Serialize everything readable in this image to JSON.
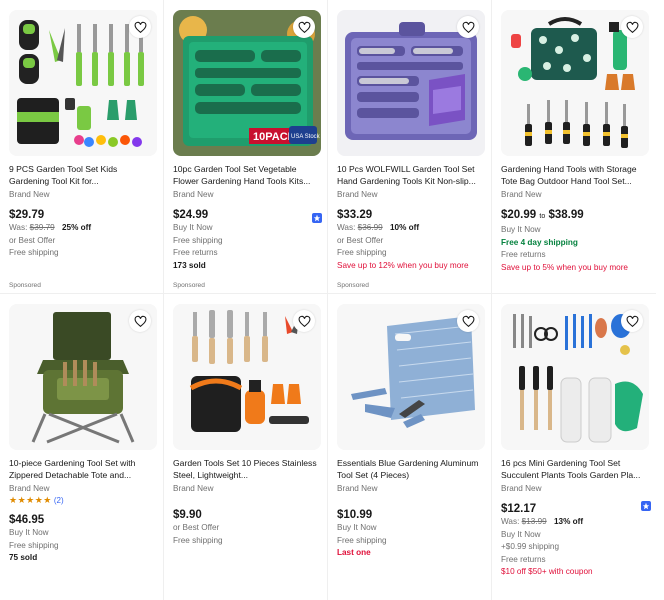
{
  "listings": [
    {
      "title": "9 PCS Garden Tool Set Kids Gardening Tool Kit for...",
      "condition": "Brand New",
      "price": "$29.79",
      "was_label": "Was:",
      "was_price": "$39.79",
      "discount": "25% off",
      "lines": [
        "or Best Offer",
        "Free shipping"
      ],
      "sponsored": "Sponsored",
      "image_icon": "garden-tool-kit-with-bag-image"
    },
    {
      "title": "10pc Garden Tool Set Vegetable Flower Gardening Hand Tools Kits...",
      "condition": "Brand New",
      "price": "$24.99",
      "lines": [
        "Buy It Now",
        "Free shipping",
        "Free returns"
      ],
      "sold": "173 sold",
      "sponsored": "Sponsored",
      "image_icon": "green-tool-case-image",
      "image_text": "10PACK",
      "image_stock_text": "USA Stock"
    },
    {
      "title": "10 Pcs WOLFWILL Garden Tool Set Hand Gardening Tools Kit Non-slip...",
      "condition": "Brand New",
      "price": "$33.29",
      "was_label": "Was:",
      "was_price": "$36.99",
      "discount": "10% off",
      "lines": [
        "or Best Offer",
        "Free shipping"
      ],
      "promo": "Save up to 12% when you buy more",
      "sponsored": "Sponsored",
      "image_icon": "purple-tool-case-image"
    },
    {
      "title": "Gardening Hand Tools with Storage Tote Bag Outdoor Hand Tool Set...",
      "condition": "Brand New",
      "price": "$20.99",
      "price_to": "to",
      "price_high": "$38.99",
      "lines": [
        "Buy It Now"
      ],
      "shipping_highlight": "Free 4 day shipping",
      "lines_after": [
        "Free returns"
      ],
      "promo": "Save up to 5% when you buy more",
      "image_icon": "tote-bag-tool-set-image"
    },
    {
      "title": "10-piece Gardening Tool Set with Zippered Detachable Tote and...",
      "condition": "Brand New",
      "stars": "★★★★★",
      "review_count": "(2)",
      "price": "$46.95",
      "lines": [
        "Buy It Now",
        "Free shipping"
      ],
      "sold": "75 sold",
      "image_icon": "folding-stool-tote-image"
    },
    {
      "title": "Garden Tools Set 10 Pieces Stainless Steel, Lightweight...",
      "condition": "Brand New",
      "price": "$9.90",
      "lines": [
        "or Best Offer",
        "Free shipping"
      ],
      "image_icon": "stainless-tools-set-image"
    },
    {
      "title": "Essentials Blue Gardening Aluminum Tool Set (4 Pieces)",
      "condition": "Brand New",
      "price": "$10.99",
      "lines": [
        "Buy It Now",
        "Free shipping"
      ],
      "promo": "Last one",
      "image_icon": "blue-tool-set-image"
    },
    {
      "title": "16 pcs Mini Gardening Tool Set Succulent Plants Tools Garden Pla...",
      "condition": "Brand New",
      "price": "$12.17",
      "was_label": "Was:",
      "was_price": "$13.99",
      "discount": "13% off",
      "lines": [
        "Buy It Now",
        "+$0.99 shipping",
        "Free returns"
      ],
      "promo": "$10 off $50+ with coupon",
      "image_icon": "mini-succulent-tools-image"
    }
  ],
  "colors": {
    "link_blue": "#3665f3",
    "promo_red": "#e0103a",
    "shipping_green": "#05823f",
    "muted": "#707070"
  }
}
